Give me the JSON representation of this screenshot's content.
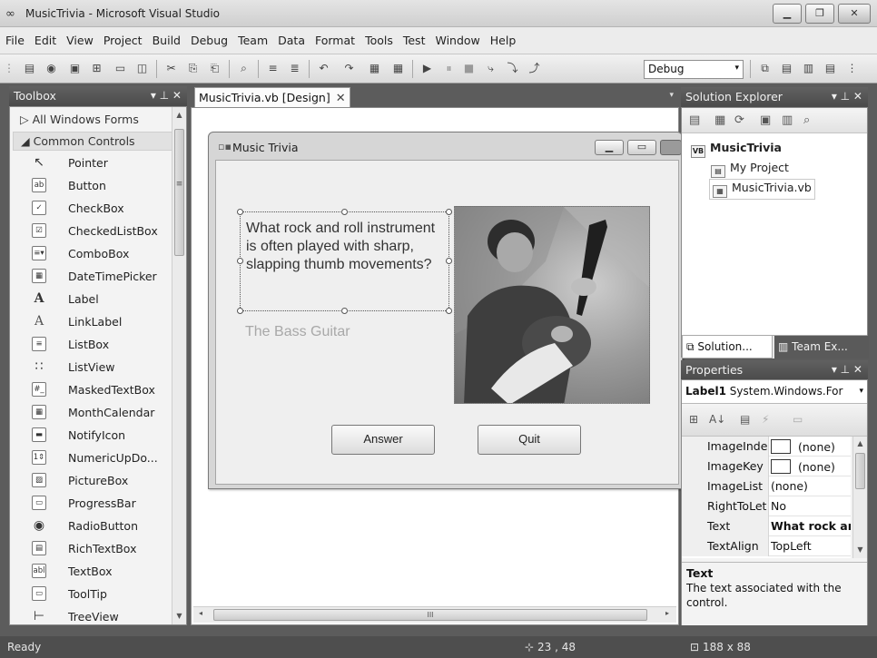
{
  "window": {
    "title": "MusicTrivia - Microsoft Visual Studio",
    "controls": {
      "minimize": "▁",
      "maximize": "❐",
      "close": "✕"
    }
  },
  "menu": [
    "File",
    "Edit",
    "View",
    "Project",
    "Build",
    "Debug",
    "Team",
    "Data",
    "Format",
    "Tools",
    "Test",
    "Window",
    "Help"
  ],
  "toolbar": {
    "configuration": "Debug",
    "config_arrow": "▾",
    "icons": {
      "new_project": "▤",
      "add_item": "◉",
      "open": "▣",
      "add": "⊞",
      "save": "▭",
      "save_all": "◫",
      "cut": "✂",
      "copy": "⎘",
      "paste": "⎗",
      "find": "⌕",
      "indent": "≡",
      "outdent": "≣",
      "undo": "↶",
      "redo": "↷",
      "navigate": "▦",
      "start": "▶",
      "pause": "⏸",
      "stop": "■",
      "step": "⤷",
      "step_into": "⤵",
      "step_out": "⤴",
      "solution": "⧉",
      "props": "▤",
      "toolbox": "▥",
      "more": "⋮"
    }
  },
  "toolbox": {
    "title": "Toolbox",
    "header_controls": "▾ ⊥ ✕",
    "groups": [
      {
        "label": "▷ All Windows Forms"
      },
      {
        "label": "◢ Common Controls"
      }
    ],
    "items": [
      {
        "label": "Pointer",
        "icon": "↖"
      },
      {
        "label": "Button",
        "icon": "ab"
      },
      {
        "label": "CheckBox",
        "icon": "✓"
      },
      {
        "label": "CheckedListBox",
        "icon": "☑"
      },
      {
        "label": "ComboBox",
        "icon": "≡▾"
      },
      {
        "label": "DateTimePicker",
        "icon": "▦"
      },
      {
        "label": "Label",
        "icon": "A"
      },
      {
        "label": "LinkLabel",
        "icon": "A"
      },
      {
        "label": "ListBox",
        "icon": "≡"
      },
      {
        "label": "ListView",
        "icon": "∷"
      },
      {
        "label": "MaskedTextBox",
        "icon": "#_"
      },
      {
        "label": "MonthCalendar",
        "icon": "▦"
      },
      {
        "label": "NotifyIcon",
        "icon": "▬"
      },
      {
        "label": "NumericUpDo...",
        "icon": "1⇕"
      },
      {
        "label": "PictureBox",
        "icon": "▨"
      },
      {
        "label": "ProgressBar",
        "icon": "▭"
      },
      {
        "label": "RadioButton",
        "icon": "◉"
      },
      {
        "label": "RichTextBox",
        "icon": "▤"
      },
      {
        "label": "TextBox",
        "icon": "abl"
      },
      {
        "label": "ToolTip",
        "icon": "▭"
      },
      {
        "label": "TreeView",
        "icon": "⊢"
      }
    ],
    "scroll": {
      "up": "▲",
      "down": "▼",
      "grip": "≡"
    }
  },
  "document": {
    "tab_label": "MusicTrivia.vb [Design]",
    "tab_close": "✕",
    "tab_dropdown": "▾",
    "form": {
      "title": "Music Trivia",
      "icon": "▫▪",
      "controls": {
        "minimize": "▁",
        "maximize": "▭"
      },
      "question_text": "What rock and roll instrument is often played with sharp, slapping thumb movements?",
      "answer_text": "The Bass Guitar",
      "answer_button": "Answer",
      "quit_button": "Quit"
    },
    "hscroll": {
      "left": "◂",
      "right": "▸",
      "grip": "III"
    }
  },
  "solution_explorer": {
    "title": "Solution Explorer",
    "header_controls": "▾ ⊥ ✕",
    "toolbar_icons": [
      "▤",
      "▦",
      "⟳",
      "▣",
      "▥",
      "⌕"
    ],
    "items": [
      {
        "label": "MusicTrivia",
        "icon": "VB"
      },
      {
        "label": "My Project",
        "icon": "▤"
      },
      {
        "label": "MusicTrivia.vb",
        "icon": "▦"
      }
    ],
    "tabs": [
      {
        "label": "Solution...",
        "icon": "⧉"
      },
      {
        "label": "Team Ex...",
        "icon": "▥"
      }
    ]
  },
  "properties": {
    "title": "Properties",
    "header_controls": "▾ ⊥ ✕",
    "object_name": "Label1",
    "object_type": "System.Windows.For",
    "object_arrow": "▾",
    "toolbar_icons": [
      "⊞",
      "A↓",
      "▤",
      "⚡",
      "▭"
    ],
    "rows": [
      {
        "name": "ImageInde",
        "value": "(none)",
        "swatch": true,
        "bold": false
      },
      {
        "name": "ImageKey",
        "value": "(none)",
        "swatch": true,
        "bold": false
      },
      {
        "name": "ImageList",
        "value": "(none)",
        "swatch": false,
        "bold": false
      },
      {
        "name": "RightToLet",
        "value": "No",
        "swatch": false,
        "bold": false
      },
      {
        "name": "Text",
        "value": "What rock ar",
        "swatch": false,
        "bold": true
      },
      {
        "name": "TextAlign",
        "value": "TopLeft",
        "swatch": false,
        "bold": false
      }
    ],
    "desc_title": "Text",
    "desc_body": "The text associated with the control.",
    "scroll": {
      "up": "▲",
      "down": "▼"
    }
  },
  "status": {
    "text": "Ready",
    "location_icon": "⊹",
    "location": "23 , 48",
    "size_icon": "⊡",
    "size": "188 x 88"
  }
}
